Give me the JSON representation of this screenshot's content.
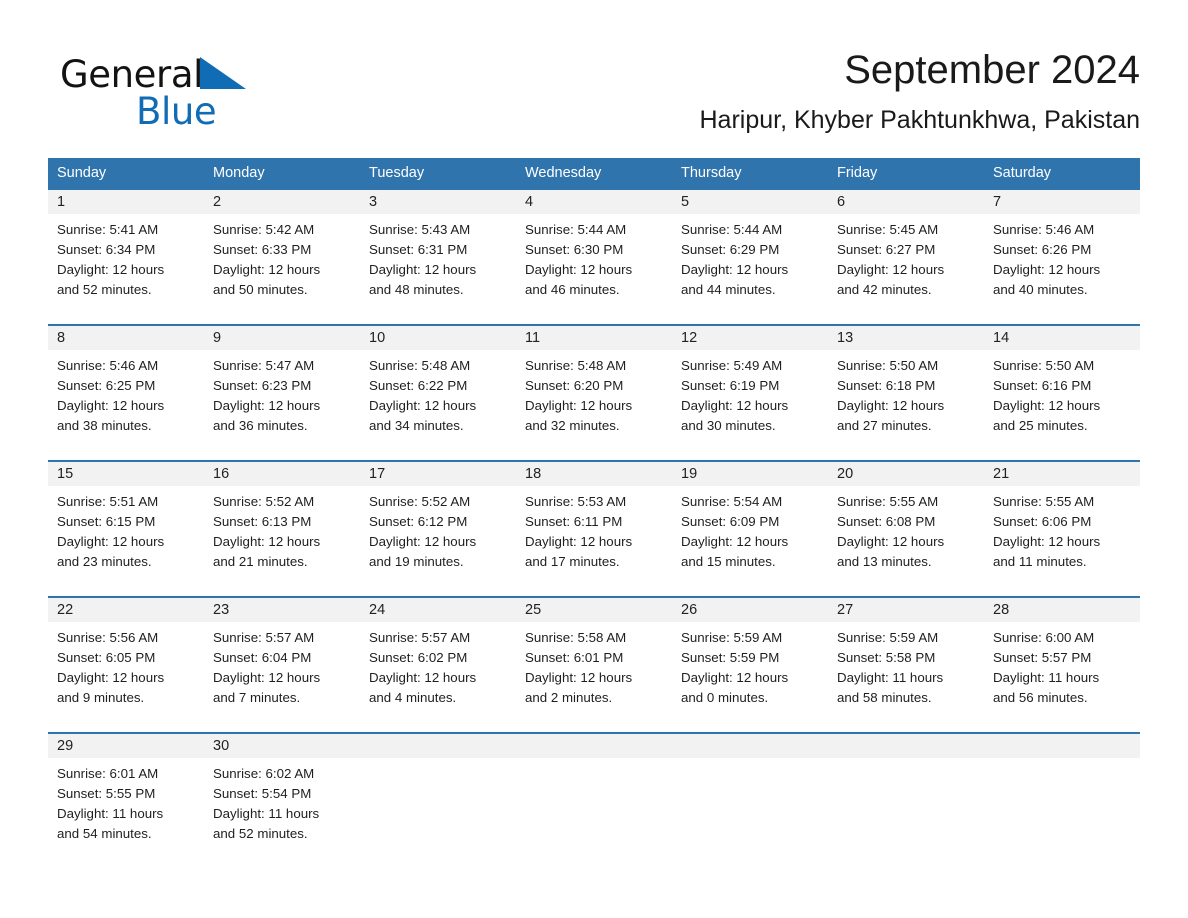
{
  "brand": {
    "name_part1": "General",
    "name_part2": "Blue",
    "logo_color": "#0f6cb5",
    "triangle_icon": "triangle-icon"
  },
  "header": {
    "title": "September 2024",
    "subtitle": "Haripur, Khyber Pakhtunkhwa, Pakistan"
  },
  "theme": {
    "header_blue": "#3074ae",
    "daynum_row_gray": "#f2f2f2",
    "text_color": "#1f1f1f"
  },
  "calendar": {
    "weekday_headers": [
      "Sunday",
      "Monday",
      "Tuesday",
      "Wednesday",
      "Thursday",
      "Friday",
      "Saturday"
    ],
    "weeks": [
      {
        "days": [
          {
            "num": "1",
            "sunrise": "Sunrise: 5:41 AM",
            "sunset": "Sunset: 6:34 PM",
            "daylight_1": "Daylight: 12 hours",
            "daylight_2": "and 52 minutes."
          },
          {
            "num": "2",
            "sunrise": "Sunrise: 5:42 AM",
            "sunset": "Sunset: 6:33 PM",
            "daylight_1": "Daylight: 12 hours",
            "daylight_2": "and 50 minutes."
          },
          {
            "num": "3",
            "sunrise": "Sunrise: 5:43 AM",
            "sunset": "Sunset: 6:31 PM",
            "daylight_1": "Daylight: 12 hours",
            "daylight_2": "and 48 minutes."
          },
          {
            "num": "4",
            "sunrise": "Sunrise: 5:44 AM",
            "sunset": "Sunset: 6:30 PM",
            "daylight_1": "Daylight: 12 hours",
            "daylight_2": "and 46 minutes."
          },
          {
            "num": "5",
            "sunrise": "Sunrise: 5:44 AM",
            "sunset": "Sunset: 6:29 PM",
            "daylight_1": "Daylight: 12 hours",
            "daylight_2": "and 44 minutes."
          },
          {
            "num": "6",
            "sunrise": "Sunrise: 5:45 AM",
            "sunset": "Sunset: 6:27 PM",
            "daylight_1": "Daylight: 12 hours",
            "daylight_2": "and 42 minutes."
          },
          {
            "num": "7",
            "sunrise": "Sunrise: 5:46 AM",
            "sunset": "Sunset: 6:26 PM",
            "daylight_1": "Daylight: 12 hours",
            "daylight_2": "and 40 minutes."
          }
        ]
      },
      {
        "days": [
          {
            "num": "8",
            "sunrise": "Sunrise: 5:46 AM",
            "sunset": "Sunset: 6:25 PM",
            "daylight_1": "Daylight: 12 hours",
            "daylight_2": "and 38 minutes."
          },
          {
            "num": "9",
            "sunrise": "Sunrise: 5:47 AM",
            "sunset": "Sunset: 6:23 PM",
            "daylight_1": "Daylight: 12 hours",
            "daylight_2": "and 36 minutes."
          },
          {
            "num": "10",
            "sunrise": "Sunrise: 5:48 AM",
            "sunset": "Sunset: 6:22 PM",
            "daylight_1": "Daylight: 12 hours",
            "daylight_2": "and 34 minutes."
          },
          {
            "num": "11",
            "sunrise": "Sunrise: 5:48 AM",
            "sunset": "Sunset: 6:20 PM",
            "daylight_1": "Daylight: 12 hours",
            "daylight_2": "and 32 minutes."
          },
          {
            "num": "12",
            "sunrise": "Sunrise: 5:49 AM",
            "sunset": "Sunset: 6:19 PM",
            "daylight_1": "Daylight: 12 hours",
            "daylight_2": "and 30 minutes."
          },
          {
            "num": "13",
            "sunrise": "Sunrise: 5:50 AM",
            "sunset": "Sunset: 6:18 PM",
            "daylight_1": "Daylight: 12 hours",
            "daylight_2": "and 27 minutes."
          },
          {
            "num": "14",
            "sunrise": "Sunrise: 5:50 AM",
            "sunset": "Sunset: 6:16 PM",
            "daylight_1": "Daylight: 12 hours",
            "daylight_2": "and 25 minutes."
          }
        ]
      },
      {
        "days": [
          {
            "num": "15",
            "sunrise": "Sunrise: 5:51 AM",
            "sunset": "Sunset: 6:15 PM",
            "daylight_1": "Daylight: 12 hours",
            "daylight_2": "and 23 minutes."
          },
          {
            "num": "16",
            "sunrise": "Sunrise: 5:52 AM",
            "sunset": "Sunset: 6:13 PM",
            "daylight_1": "Daylight: 12 hours",
            "daylight_2": "and 21 minutes."
          },
          {
            "num": "17",
            "sunrise": "Sunrise: 5:52 AM",
            "sunset": "Sunset: 6:12 PM",
            "daylight_1": "Daylight: 12 hours",
            "daylight_2": "and 19 minutes."
          },
          {
            "num": "18",
            "sunrise": "Sunrise: 5:53 AM",
            "sunset": "Sunset: 6:11 PM",
            "daylight_1": "Daylight: 12 hours",
            "daylight_2": "and 17 minutes."
          },
          {
            "num": "19",
            "sunrise": "Sunrise: 5:54 AM",
            "sunset": "Sunset: 6:09 PM",
            "daylight_1": "Daylight: 12 hours",
            "daylight_2": "and 15 minutes."
          },
          {
            "num": "20",
            "sunrise": "Sunrise: 5:55 AM",
            "sunset": "Sunset: 6:08 PM",
            "daylight_1": "Daylight: 12 hours",
            "daylight_2": "and 13 minutes."
          },
          {
            "num": "21",
            "sunrise": "Sunrise: 5:55 AM",
            "sunset": "Sunset: 6:06 PM",
            "daylight_1": "Daylight: 12 hours",
            "daylight_2": "and 11 minutes."
          }
        ]
      },
      {
        "days": [
          {
            "num": "22",
            "sunrise": "Sunrise: 5:56 AM",
            "sunset": "Sunset: 6:05 PM",
            "daylight_1": "Daylight: 12 hours",
            "daylight_2": "and 9 minutes."
          },
          {
            "num": "23",
            "sunrise": "Sunrise: 5:57 AM",
            "sunset": "Sunset: 6:04 PM",
            "daylight_1": "Daylight: 12 hours",
            "daylight_2": "and 7 minutes."
          },
          {
            "num": "24",
            "sunrise": "Sunrise: 5:57 AM",
            "sunset": "Sunset: 6:02 PM",
            "daylight_1": "Daylight: 12 hours",
            "daylight_2": "and 4 minutes."
          },
          {
            "num": "25",
            "sunrise": "Sunrise: 5:58 AM",
            "sunset": "Sunset: 6:01 PM",
            "daylight_1": "Daylight: 12 hours",
            "daylight_2": "and 2 minutes."
          },
          {
            "num": "26",
            "sunrise": "Sunrise: 5:59 AM",
            "sunset": "Sunset: 5:59 PM",
            "daylight_1": "Daylight: 12 hours",
            "daylight_2": "and 0 minutes."
          },
          {
            "num": "27",
            "sunrise": "Sunrise: 5:59 AM",
            "sunset": "Sunset: 5:58 PM",
            "daylight_1": "Daylight: 11 hours",
            "daylight_2": "and 58 minutes."
          },
          {
            "num": "28",
            "sunrise": "Sunrise: 6:00 AM",
            "sunset": "Sunset: 5:57 PM",
            "daylight_1": "Daylight: 11 hours",
            "daylight_2": "and 56 minutes."
          }
        ]
      },
      {
        "days": [
          {
            "num": "29",
            "sunrise": "Sunrise: 6:01 AM",
            "sunset": "Sunset: 5:55 PM",
            "daylight_1": "Daylight: 11 hours",
            "daylight_2": "and 54 minutes."
          },
          {
            "num": "30",
            "sunrise": "Sunrise: 6:02 AM",
            "sunset": "Sunset: 5:54 PM",
            "daylight_1": "Daylight: 11 hours",
            "daylight_2": "and 52 minutes."
          },
          {
            "num": "",
            "sunrise": "",
            "sunset": "",
            "daylight_1": "",
            "daylight_2": ""
          },
          {
            "num": "",
            "sunrise": "",
            "sunset": "",
            "daylight_1": "",
            "daylight_2": ""
          },
          {
            "num": "",
            "sunrise": "",
            "sunset": "",
            "daylight_1": "",
            "daylight_2": ""
          },
          {
            "num": "",
            "sunrise": "",
            "sunset": "",
            "daylight_1": "",
            "daylight_2": ""
          },
          {
            "num": "",
            "sunrise": "",
            "sunset": "",
            "daylight_1": "",
            "daylight_2": ""
          }
        ]
      }
    ]
  }
}
